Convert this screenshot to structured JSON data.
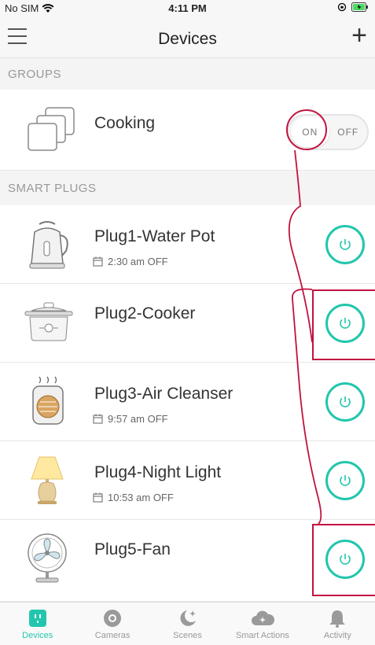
{
  "status_bar": {
    "carrier": "No SIM",
    "time": "4:11 PM"
  },
  "nav": {
    "title": "Devices"
  },
  "groups": {
    "header": "GROUPS",
    "items": [
      {
        "name": "Cooking",
        "on_label": "ON",
        "off_label": "OFF"
      }
    ]
  },
  "smart_plugs": {
    "header": "SMART PLUGS",
    "items": [
      {
        "name": "Plug1-Water Pot",
        "schedule": "2:30 am OFF"
      },
      {
        "name": "Plug2-Cooker",
        "schedule": ""
      },
      {
        "name": "Plug3-Air Cleanser",
        "schedule": "9:57 am OFF"
      },
      {
        "name": "Plug4-Night Light",
        "schedule": "10:53 am OFF"
      },
      {
        "name": "Plug5-Fan",
        "schedule": ""
      }
    ]
  },
  "tabs": [
    {
      "label": "Devices",
      "active": true
    },
    {
      "label": "Cameras",
      "active": false
    },
    {
      "label": "Scenes",
      "active": false
    },
    {
      "label": "Smart Actions",
      "active": false
    },
    {
      "label": "Activity",
      "active": false
    }
  ],
  "colors": {
    "accent": "#22c6ad",
    "annotation": "#c2123f"
  }
}
